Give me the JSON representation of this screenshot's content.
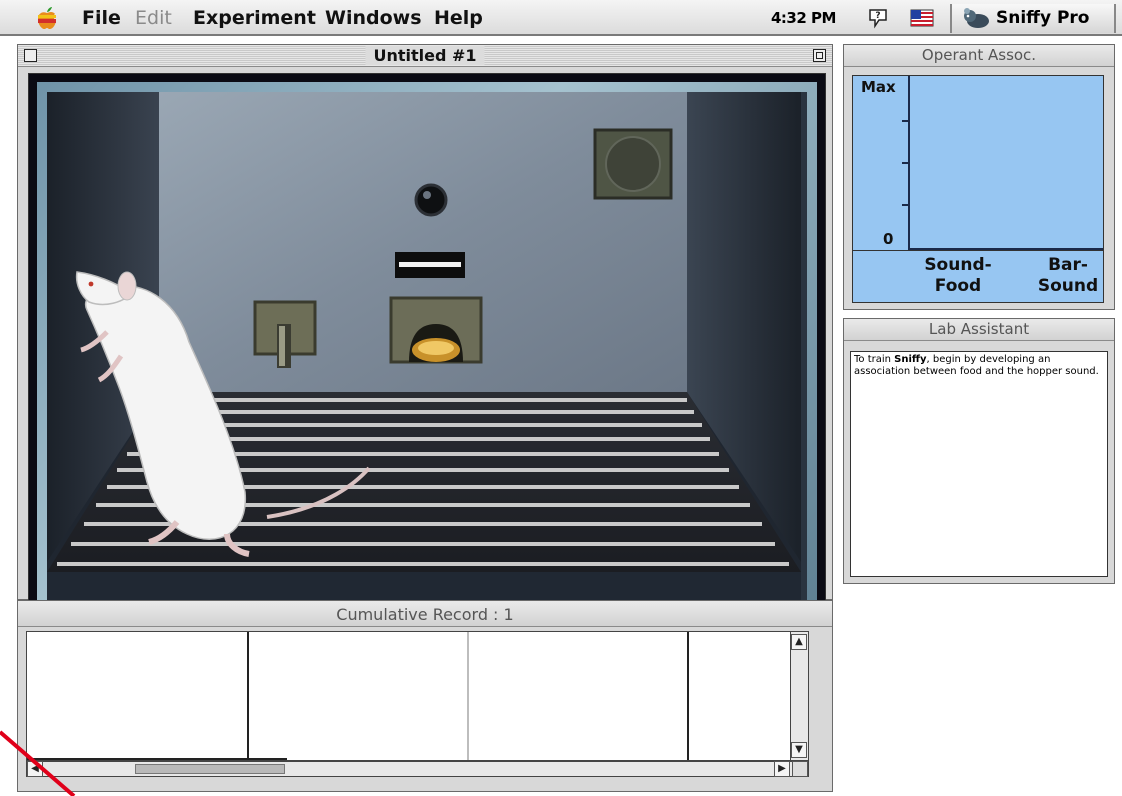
{
  "menubar": {
    "menus": [
      {
        "label": "File",
        "enabled": true
      },
      {
        "label": "Edit",
        "enabled": false
      },
      {
        "label": "Experiment",
        "enabled": true
      },
      {
        "label": "Windows",
        "enabled": true
      },
      {
        "label": "Help",
        "enabled": true
      }
    ],
    "clock": "4:32 PM",
    "app_switcher": "Sniffy Pro"
  },
  "chamber_window": {
    "title": "Untitled #1"
  },
  "operant_window": {
    "title": "Operant Assoc.",
    "y_max_label": "Max",
    "y_zero_label": "0",
    "categories": [
      "Sound-\nFood",
      "Bar-\nSound"
    ],
    "values": [
      0,
      0
    ]
  },
  "lab_assistant": {
    "title": "Lab Assistant",
    "message_prefix": "To train ",
    "message_name": "Sniffy",
    "message_suffix": ", begin by developing an association between food and the hopper sound."
  },
  "cumulative_record": {
    "title": "Cumulative Record : 1"
  },
  "colors": {
    "plot_bg": "#97c6f2",
    "panel_bg": "#d8d8d8",
    "annotation": "#e0001a"
  }
}
